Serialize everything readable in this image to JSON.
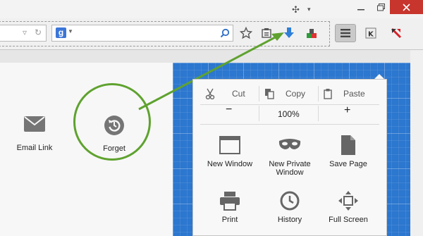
{
  "window": {
    "minimize_label": "minimize",
    "maximize_label": "maximize",
    "close_label": "close"
  },
  "toolbar": {
    "search_engine": "g",
    "icons": [
      "star-icon",
      "clipboard-icon",
      "download-icon",
      "puzzle-icon",
      "menu-icon",
      "k-addon-icon",
      "kaspersky-icon"
    ]
  },
  "page": {
    "email_link": "Email Link",
    "forget": "Forget"
  },
  "menu": {
    "cut": "Cut",
    "copy": "Copy",
    "paste": "Paste",
    "zoom_out": "−",
    "zoom_level": "100%",
    "zoom_in": "+",
    "tiles": [
      {
        "label": "New Window"
      },
      {
        "label": "New Private Window"
      },
      {
        "label": "Save Page"
      },
      {
        "label": "Print"
      },
      {
        "label": "History"
      },
      {
        "label": "Full Screen"
      }
    ]
  },
  "colors": {
    "highlight": "#5fa22f",
    "download_arrow": "#2f7fd6",
    "blueprint": "#2c77cf",
    "close": "#c7352c"
  }
}
